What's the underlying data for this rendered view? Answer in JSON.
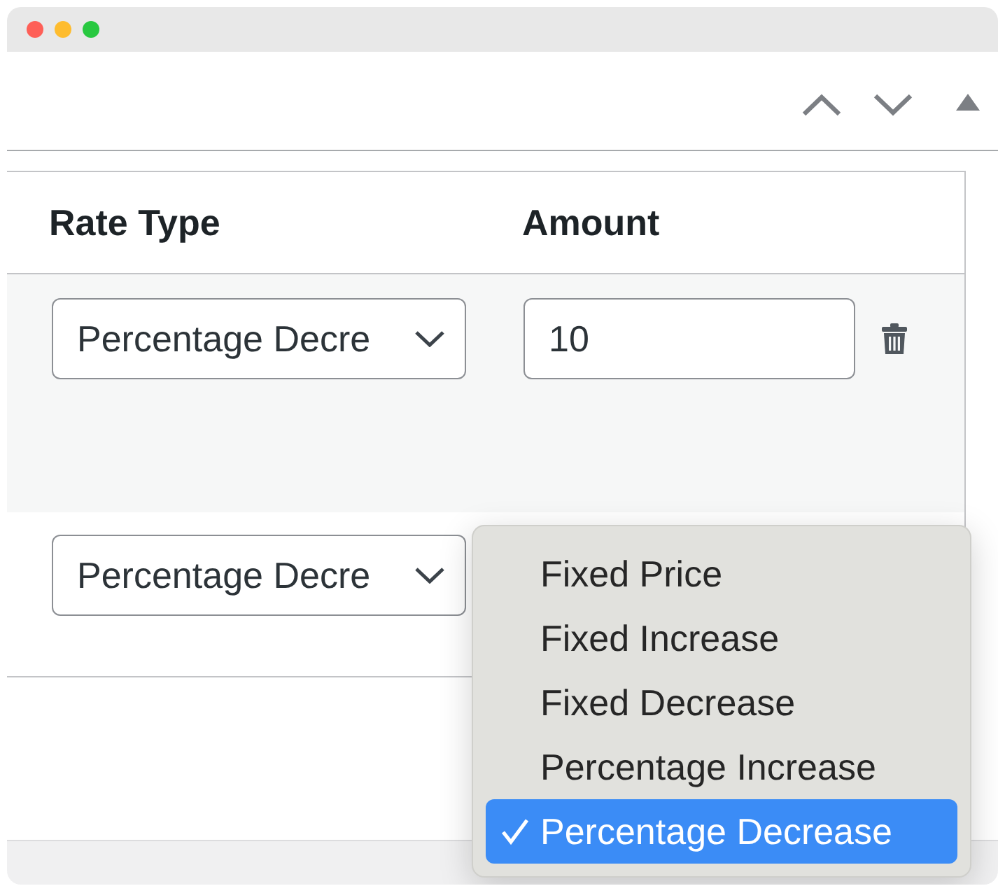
{
  "table": {
    "columns": [
      "Rate Type",
      "Amount"
    ],
    "rows": [
      {
        "rate_type": "Percentage Decre",
        "amount": "10",
        "removable": true,
        "highlighted": true
      },
      {
        "rate_type": "Percentage Decre"
      }
    ]
  },
  "dropdown_menu": {
    "items": [
      {
        "label": "Fixed Price",
        "selected": false
      },
      {
        "label": "Fixed Increase",
        "selected": false
      },
      {
        "label": "Fixed Decrease",
        "selected": false
      },
      {
        "label": "Percentage Increase",
        "selected": false
      },
      {
        "label": "Percentage Decrease",
        "selected": true
      }
    ]
  }
}
